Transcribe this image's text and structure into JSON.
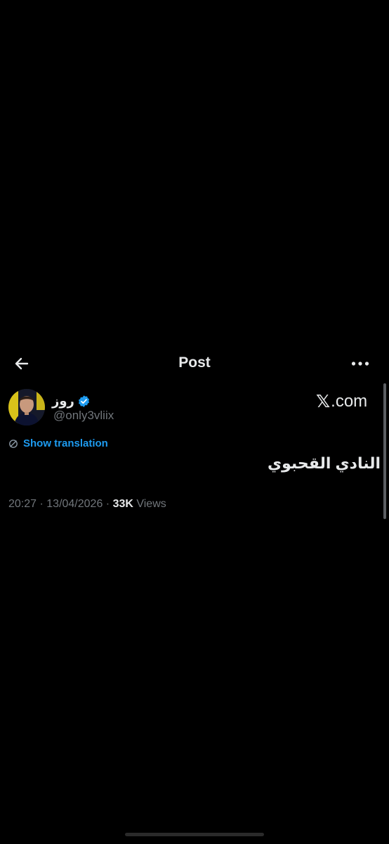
{
  "header": {
    "title": "Post",
    "back_icon": "arrow-left-icon",
    "more_icon": "more-horizontal-icon"
  },
  "author": {
    "display_name": "روز",
    "handle": "@only3vliix",
    "verified": true,
    "verified_color": "#1d9bf0",
    "avatar": "avatar-photo"
  },
  "watermark": {
    "x_glyph": "𝕏",
    "domain": ".com"
  },
  "translation": {
    "label": "Show translation",
    "icon": "translate-icon",
    "color": "#1d9bf0"
  },
  "post": {
    "text": "النادي القحبوي"
  },
  "meta": {
    "time": "20:27",
    "sep1": " · ",
    "date": "13/04/2026",
    "sep2": " · ",
    "views_count": "33K",
    "views_label": " Views"
  },
  "colors": {
    "background": "#000000",
    "primary_text": "#e7e9ea",
    "secondary_text": "#71767b",
    "accent": "#1d9bf0"
  }
}
